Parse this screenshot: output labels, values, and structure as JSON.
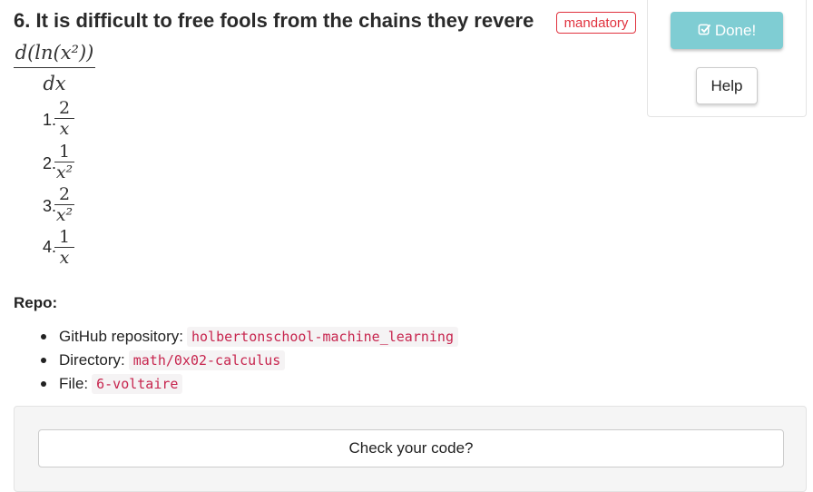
{
  "task": {
    "title": "6. It is difficult to free fools from the chains they revere",
    "badge": "mandatory"
  },
  "actions": {
    "done_label": "Done!",
    "done_icon": "check-square-icon",
    "help_label": "Help"
  },
  "question": {
    "numerator": "d(ln(x²))",
    "denominator": "dx"
  },
  "options": [
    {
      "number": "1.",
      "numerator": "2",
      "denominator": "x"
    },
    {
      "number": "2.",
      "numerator": "1",
      "denominator": "x²"
    },
    {
      "number": "3.",
      "numerator": "2",
      "denominator": "x²"
    },
    {
      "number": "4.",
      "numerator": "1",
      "denominator": "x"
    }
  ],
  "repo": {
    "label": "Repo:",
    "items": [
      {
        "label": "GitHub repository:",
        "value": "holbertonschool-machine_learning"
      },
      {
        "label": "Directory:",
        "value": "math/0x02-calculus"
      },
      {
        "label": "File:",
        "value": "6-voltaire"
      }
    ]
  },
  "check": {
    "label": "Check your code?"
  },
  "colors": {
    "done_bg": "#7fcdd3",
    "badge": "#e0323e",
    "code_text": "#c7254e"
  }
}
